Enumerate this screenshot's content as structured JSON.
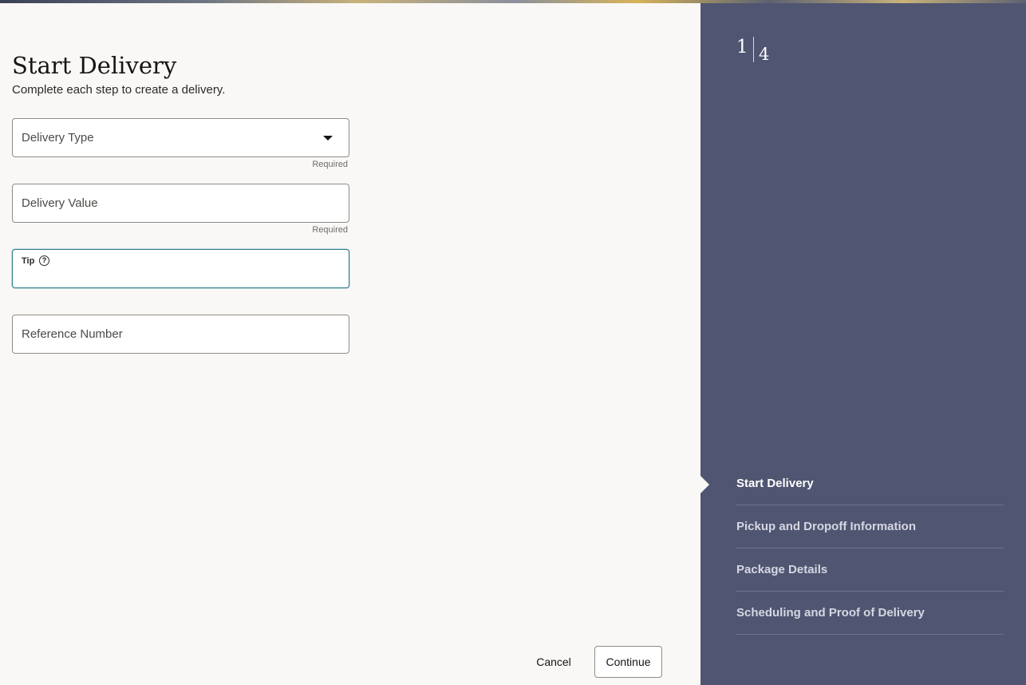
{
  "page": {
    "title": "Start Delivery",
    "subtitle": "Complete each step to create a delivery."
  },
  "form": {
    "delivery_type": {
      "label": "Delivery Type",
      "helper": "Required",
      "value": ""
    },
    "delivery_value": {
      "label": "Delivery Value",
      "helper": "Required",
      "value": ""
    },
    "tip": {
      "label": "Tip",
      "help_icon": "?",
      "value": ""
    },
    "reference_number": {
      "label": "Reference Number",
      "value": ""
    }
  },
  "actions": {
    "cancel_label": "Cancel",
    "continue_label": "Continue"
  },
  "sidebar": {
    "current_step": "1",
    "total_steps": "4",
    "steps": [
      {
        "label": "Start Delivery",
        "active": true
      },
      {
        "label": "Pickup and Dropoff Information",
        "active": false
      },
      {
        "label": "Package Details",
        "active": false
      },
      {
        "label": "Scheduling and Proof of Delivery",
        "active": false
      }
    ]
  },
  "colors": {
    "sidebar_bg": "#505571",
    "page_bg": "#faf8f6",
    "focus_border": "#2f7f8f"
  }
}
